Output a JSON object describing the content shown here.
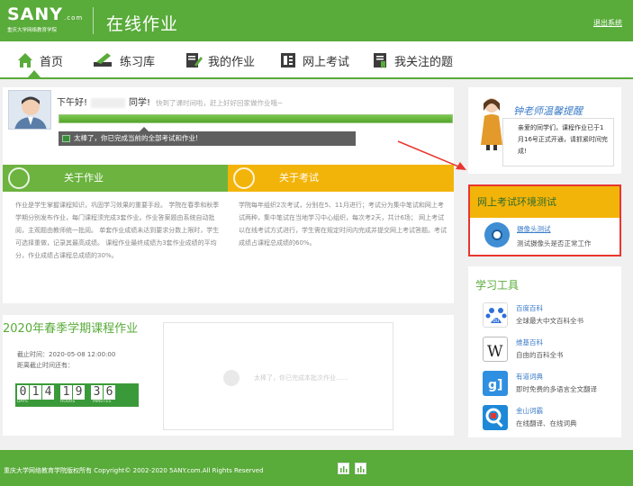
{
  "header": {
    "logo_text": "SANY",
    "logo_suffix": ".com",
    "logo_sub": "重庆大学网络教育学院",
    "title": "在线作业",
    "logout": "退出系统"
  },
  "nav": {
    "items": [
      {
        "label": "首页",
        "icon": "home-icon"
      },
      {
        "label": "练习库",
        "icon": "pencil-icon"
      },
      {
        "label": "我的作业",
        "icon": "edit-doc-icon"
      },
      {
        "label": "网上考试",
        "icon": "book-icon"
      },
      {
        "label": "我关注的题",
        "icon": "bookmark-icon"
      }
    ]
  },
  "welcome": {
    "greeting": "下午好!",
    "student_suffix": "同学!",
    "tip": "快到了课时间啦，赶上好好回家做作业哦~",
    "progress": 1.0,
    "done_message": "太棒了，你已完成当前的全部考试和作业!"
  },
  "about_homework": {
    "title": "关于作业",
    "text": "作业是学生掌握课程知识，巩固学习效果的重要手段。 学院在春季和秋季学期分别发布作业，每门课程须完成3套作业。作业答案题由系统自动批阅，主观题由教师统一批阅。 单套作业成绩未达到要求分数上限时，学生可选择重做，记录其最高成绩。 课程作业最终成绩为3套作业成绩的平均分，作业成绩占课程总成绩的30%。"
  },
  "about_exam": {
    "title": "关于考试",
    "text": "学院每年组织2次考试，分别在5、11月进行；考试分为集中笔试和网上考试两种，集中笔试在当地学习中心组织，每次考2天，共计6场； 网上考试以在线考试方式进行，学生需在规定时间内完成并提交网上考试答题。考试成绩占课程总成绩的60%。"
  },
  "semester": {
    "title": "2020年春季学期课程作业",
    "deadline_label": "截止时间：2020-05-08 12:00:00",
    "remaining_label": "距离截止时间还有：",
    "days": "014",
    "hours": "19",
    "minutes": "36",
    "days_label": "DAYS",
    "hours_label": "HOURS",
    "minutes_label": "MINUTES",
    "empty_message": "太棒了，你已完成本批次作业……"
  },
  "notice": {
    "title": "钟老师温馨提醒",
    "text": "亲爱的同学们，课程作业已于1月16号正式开通，请抓紧时间完成!"
  },
  "env_test": {
    "title": "网上考试环境测试",
    "item_name": "摄像头测试",
    "item_desc": "测试摄像头是否正常工作"
  },
  "tools": {
    "title": "学习工具",
    "items": [
      {
        "name": "百度百科",
        "desc": "全球最大中文百科全书",
        "icon": "baidu-icon",
        "color": "#2f6fd8"
      },
      {
        "name": "维基百科",
        "desc": "自由的百科全书",
        "icon": "wikipedia-icon",
        "color": "#ffffff"
      },
      {
        "name": "有道词典",
        "desc": "即时免费的多语言全文翻译",
        "icon": "youdao-icon",
        "color": "#2f8fe0"
      },
      {
        "name": "金山词霸",
        "desc": "在线翻译、在线词典",
        "icon": "iciba-icon",
        "color": "#1e88d8"
      }
    ]
  },
  "footer": {
    "copyright": "重庆大学网络教育学院版权所有 Copyright© 2002-2020 5ANY.com.All Rights Reserved"
  },
  "colors": {
    "brand_green": "#59ab3a",
    "exam_yellow": "#f3b409",
    "highlight_red": "#e8362e"
  }
}
